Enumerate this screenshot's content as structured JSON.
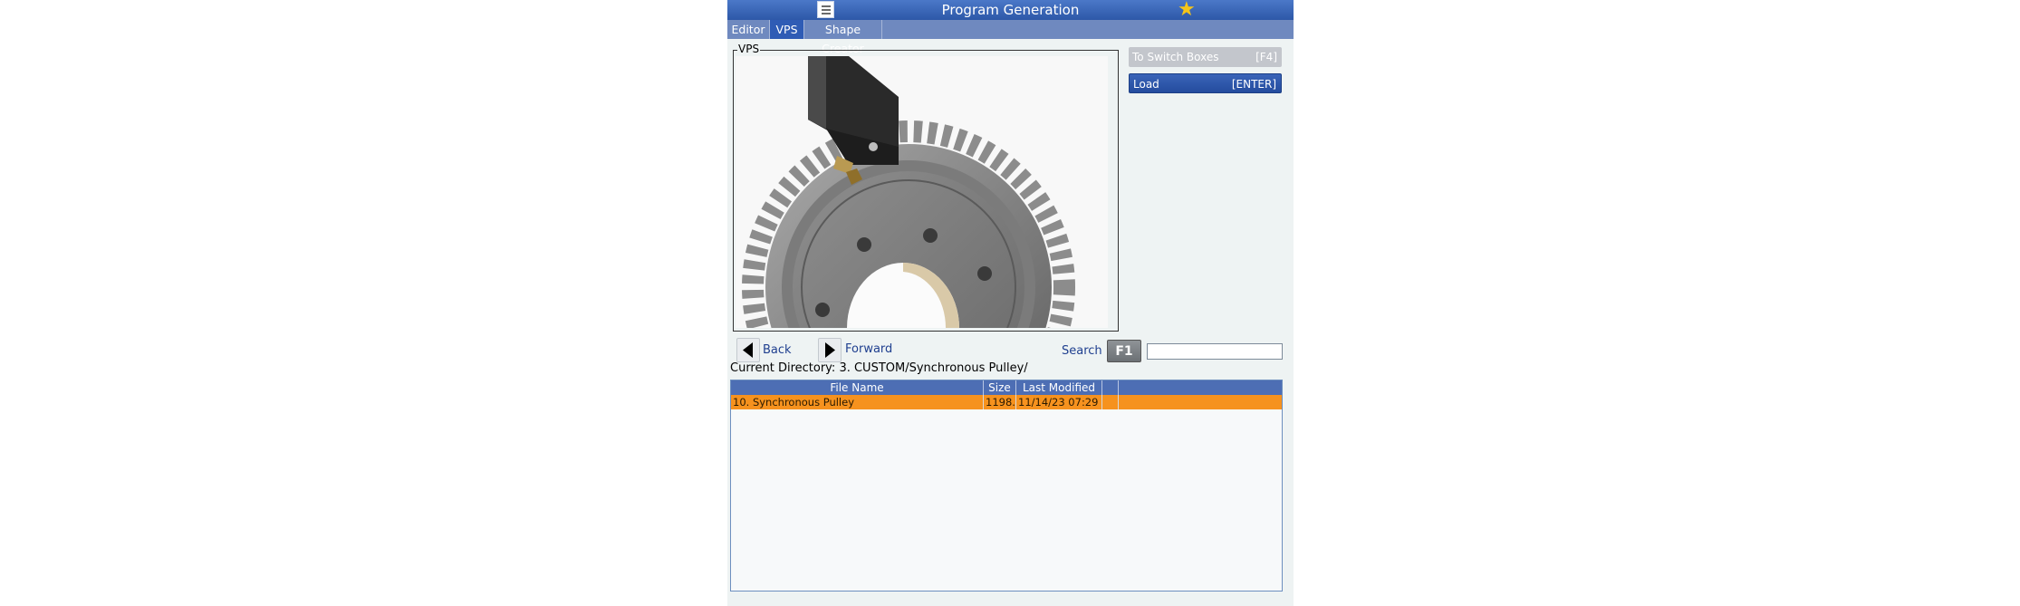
{
  "window": {
    "title": "Program Generation"
  },
  "tabs": [
    {
      "label": "Editor"
    },
    {
      "label": "VPS"
    },
    {
      "label": "Shape Creator"
    }
  ],
  "vps": {
    "label": "VPS"
  },
  "buttons": {
    "switch_boxes": {
      "label": "To Switch Boxes",
      "key": "[F4]"
    },
    "load": {
      "label": "Load",
      "key": "[ENTER]"
    }
  },
  "nav": {
    "back_label": "Back",
    "forward_label": "Forward"
  },
  "search": {
    "label": "Search",
    "key": "F1",
    "value": ""
  },
  "current_directory": "Current Directory: 3. CUSTOM/Synchronous Pulley/",
  "file_table": {
    "columns": [
      "File Name",
      "Size",
      "Last Modified",
      ""
    ],
    "rows": [
      {
        "name": "10. Synchronous Pulley",
        "size": "1198...",
        "modified": "11/14/23 07:29",
        "extra": ""
      }
    ]
  },
  "colors": {
    "titlebar": "#2d58a8",
    "active_tab": "#2f5cb5",
    "selected_row": "#f6921e",
    "star": "#f5c518"
  },
  "icons": {
    "menu": "hamburger-menu-icon",
    "favorite": "star-icon",
    "back": "triangle-left-icon",
    "forward": "triangle-right-icon"
  }
}
